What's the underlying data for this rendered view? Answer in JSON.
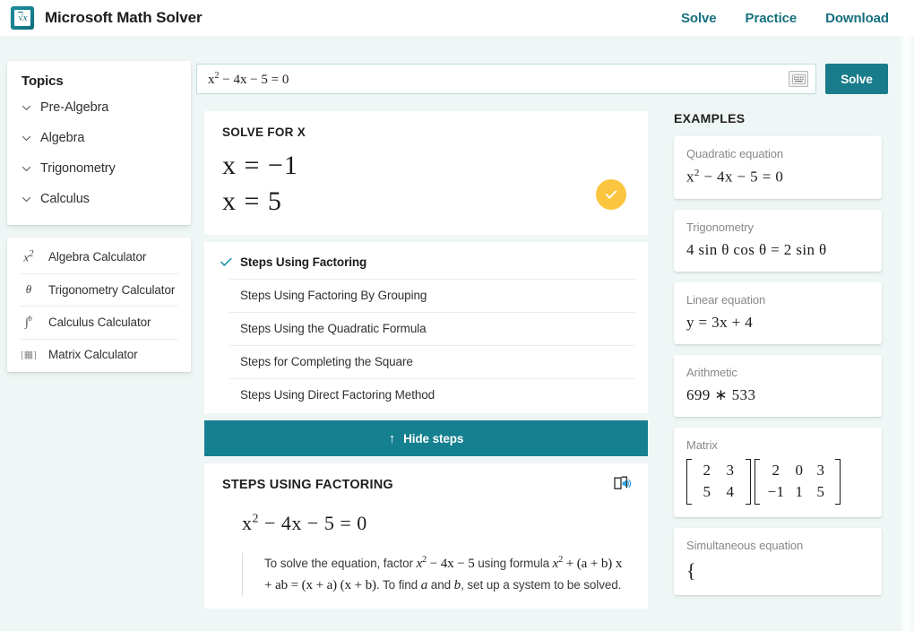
{
  "header": {
    "logo_glyph": "√x",
    "brand_title": "Microsoft Math Solver",
    "nav": [
      {
        "label": "Solve"
      },
      {
        "label": "Practice"
      },
      {
        "label": "Download"
      }
    ]
  },
  "search": {
    "expression_base": "x",
    "expression_sup": "2",
    "expression_rest": " − 4x − 5 = 0",
    "keyboard_icon": "keyboard-icon",
    "solve_label": "Solve"
  },
  "sidebar": {
    "topics_title": "Topics",
    "topics": [
      {
        "label": "Pre-Algebra",
        "icon": "chevron-down-icon"
      },
      {
        "label": "Algebra",
        "icon": "chevron-down-icon"
      },
      {
        "label": "Trigonometry",
        "icon": "chevron-down-icon"
      },
      {
        "label": "Calculus",
        "icon": "chevron-down-icon"
      }
    ],
    "calculators": [
      {
        "label": "Algebra Calculator",
        "glyph": "x²"
      },
      {
        "label": "Trigonometry Calculator",
        "glyph": "θ"
      },
      {
        "label": "Calculus Calculator",
        "glyph": "∫"
      },
      {
        "label": "Matrix Calculator",
        "glyph": "▦"
      }
    ]
  },
  "solution": {
    "title": "SOLVE FOR X",
    "answers": [
      "x = −1",
      "x = 5"
    ],
    "verified_icon": "check-circle-icon",
    "methods": [
      {
        "label": "Steps Using Factoring",
        "selected": true
      },
      {
        "label": "Steps Using Factoring By Grouping",
        "selected": false
      },
      {
        "label": "Steps Using the Quadratic Formula",
        "selected": false
      },
      {
        "label": "Steps for Completing the Square",
        "selected": false
      },
      {
        "label": "Steps Using Direct Factoring Method",
        "selected": false
      }
    ],
    "hide_steps_label": "Hide steps",
    "hide_steps_arrow": "↑"
  },
  "detail": {
    "title": "STEPS USING FACTORING",
    "read_aloud_icon": "read-aloud-icon",
    "equation_base": "x",
    "equation_sup": "2",
    "equation_rest": " − 4x − 5 = 0",
    "body_1": "To solve the equation, factor ",
    "body_expr_1": "x",
    "body_sup_1": "2",
    "body_2": " − 4x − 5",
    "body_3": " using formula ",
    "body_expr_2": "x",
    "body_sup_2": "2",
    "body_4": " + (a + b) x + ab = (x + a) (x + b)",
    "body_5": ". To find ",
    "body_expr_a": "a",
    "body_6": " and ",
    "body_expr_b": "b",
    "body_7": ", set up a system to be solved."
  },
  "examples": {
    "title": "EXAMPLES",
    "items": [
      {
        "label": "Quadratic equation",
        "type": "expr",
        "expr_base": "x",
        "expr_sup": "2",
        "expr_rest": " − 4x − 5 = 0"
      },
      {
        "label": "Trigonometry",
        "type": "plain",
        "expr": "4 sin θ cos θ = 2 sin θ"
      },
      {
        "label": "Linear equation",
        "type": "plain",
        "expr": "y = 3x + 4"
      },
      {
        "label": "Arithmetic",
        "type": "plain",
        "expr": "699 ∗ 533"
      },
      {
        "label": "Matrix",
        "type": "matrix",
        "matrix_a": [
          [
            "2",
            "3"
          ],
          [
            "5",
            "4"
          ]
        ],
        "matrix_b": [
          [
            "2",
            "0",
            "3"
          ],
          [
            "−1",
            "1",
            "5"
          ]
        ]
      },
      {
        "label": "Simultaneous equation",
        "type": "partial",
        "expr": ""
      }
    ]
  },
  "colors": {
    "brand_teal": "#15808f",
    "nav_teal": "#16707e",
    "page_bg": "#eff7f6",
    "badge_yellow": "#fbc540",
    "check_teal": "#1d9aa8"
  }
}
